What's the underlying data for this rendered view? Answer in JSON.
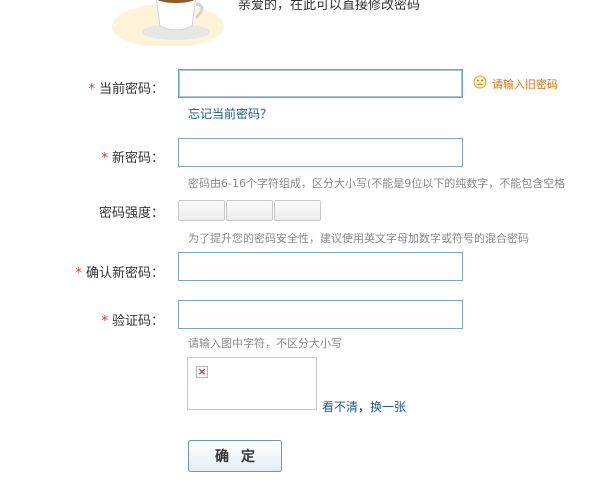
{
  "header": {
    "intro_text": "亲爱的，在此可以直接修改密码",
    "illustration": "coffee-cup-illustration"
  },
  "form": {
    "current_password": {
      "label": "当前密码：",
      "required_mark": "*",
      "value": "",
      "warning_icon": "sad-face-icon",
      "warning": "请输入旧密码",
      "forgot_link": "忘记当前密码？"
    },
    "new_password": {
      "label": "新密码：",
      "required_mark": "*",
      "value": "",
      "hint": "密码由6-16个字符组成，区分大小写(不能是9位以下的纯数字，不能包含空格"
    },
    "strength": {
      "label": "密码强度：",
      "hint": "为了提升您的密码安全性，建议使用英文字母加数字或符号的混合密码"
    },
    "confirm_password": {
      "label": "确认新密码：",
      "required_mark": "*",
      "value": ""
    },
    "captcha": {
      "label": "验证码：",
      "required_mark": "*",
      "value": "",
      "hint": "请输入图中字符，不区分大小写",
      "image_icon": "broken-image-icon",
      "refresh_link_1": "看不清",
      "separator": "，",
      "refresh_link_2": "换一张"
    },
    "submit_label": "确定"
  },
  "colors": {
    "required": "#e0322b",
    "warning": "#d9730b",
    "link": "#1b5a95",
    "input_border": "#7fa5c2"
  }
}
